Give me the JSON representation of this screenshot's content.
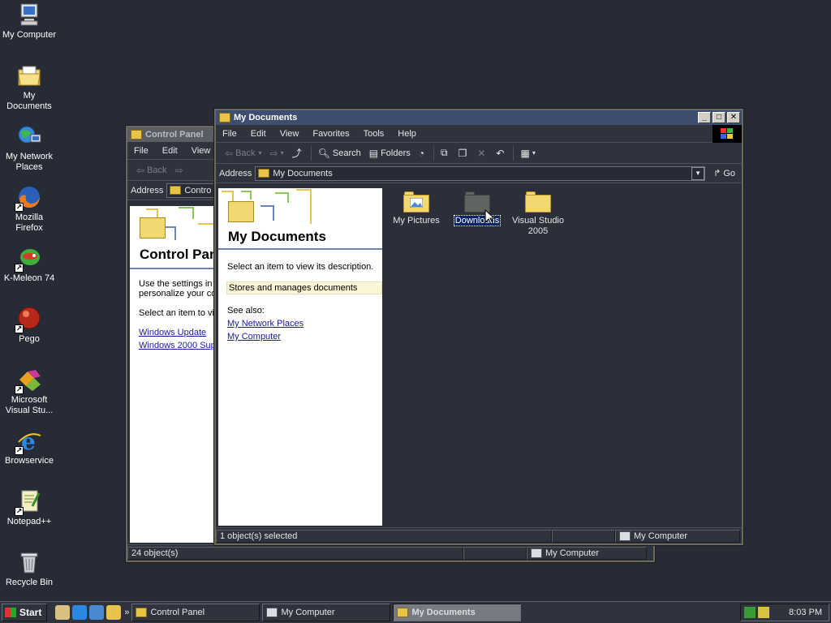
{
  "desktop": {
    "icons": [
      {
        "label": "My Computer",
        "icon": "computer-icon"
      },
      {
        "label": "My Documents",
        "icon": "documents-folder-icon"
      },
      {
        "label": "My Network Places",
        "icon": "network-places-icon"
      },
      {
        "label": "Mozilla Firefox",
        "icon": "firefox-icon"
      },
      {
        "label": "K-Meleon 74",
        "icon": "k-meleon-icon"
      },
      {
        "label": "Pego",
        "icon": "pego-icon"
      },
      {
        "label": "Microsoft Visual Stu...",
        "icon": "visual-studio-icon"
      },
      {
        "label": "Browservice",
        "icon": "internet-explorer-icon"
      },
      {
        "label": "Notepad++",
        "icon": "notepad-plus-plus-icon"
      },
      {
        "label": "Recycle Bin",
        "icon": "recycle-bin-icon"
      }
    ]
  },
  "control_panel": {
    "title": "Control Panel",
    "menu": [
      "File",
      "Edit",
      "View"
    ],
    "toolbar": {
      "back": "Back"
    },
    "address_label": "Address",
    "address_value": "Contro",
    "pane_title": "Control Pan",
    "intro_line1": "Use the settings in",
    "intro_line2": "personalize your co",
    "select_hint": "Select an item to vi",
    "links": [
      "Windows Update",
      "Windows 2000 Sup"
    ],
    "status": {
      "objects": "24 object(s)",
      "location": "My Computer"
    }
  },
  "my_documents": {
    "title": "My Documents",
    "menu": [
      "File",
      "Edit",
      "View",
      "Favorites",
      "Tools",
      "Help"
    ],
    "toolbar": {
      "back": "Back",
      "search": "Search",
      "folders": "Folders"
    },
    "address_label": "Address",
    "address_value": "My Documents",
    "go_label": "Go",
    "pane": {
      "title": "My Documents",
      "select_hint": "Select an item to view its description.",
      "description": "Stores and manages documents",
      "see_also": "See also:",
      "links": [
        "My Network Places",
        "My Computer"
      ]
    },
    "files": [
      {
        "name": "My Pictures",
        "icon": "pictures-folder-icon",
        "selected": false
      },
      {
        "name": "Downloads",
        "icon": "folder-icon",
        "selected": true
      },
      {
        "name": "Visual Studio 2005",
        "icon": "folder-icon",
        "selected": false
      }
    ],
    "status": {
      "selected": "1 object(s) selected",
      "location": "My Computer"
    }
  },
  "taskbar": {
    "start_label": "Start",
    "tasks": [
      {
        "label": "Control Panel",
        "active": false
      },
      {
        "label": "My Computer",
        "active": false
      },
      {
        "label": "My Documents",
        "active": true
      }
    ],
    "clock": "8:03 PM"
  },
  "colors": {
    "desktop": "#262b35",
    "selection": "#0a246a",
    "link": "#1a1aa6",
    "folder": "#f3d770"
  }
}
